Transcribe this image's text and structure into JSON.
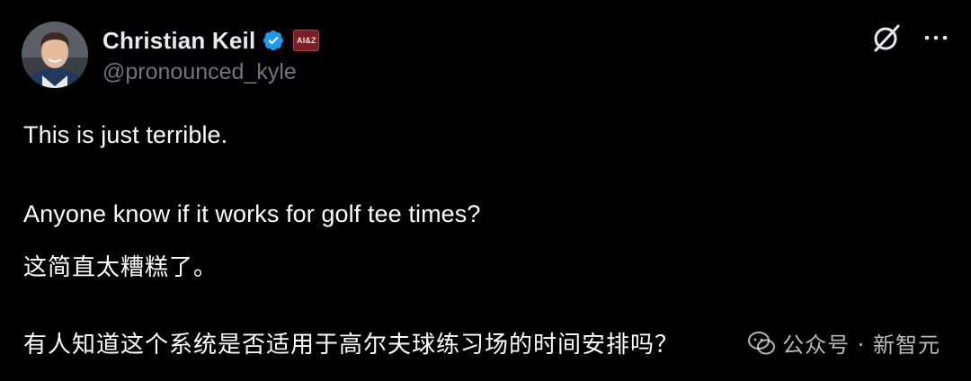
{
  "tweet": {
    "author": {
      "display_name": "Christian Keil",
      "handle": "@pronounced_kyle",
      "verified": true,
      "affiliate_badge": "AI&Z",
      "avatar": "avatar-photo"
    },
    "actions": {
      "grok_icon": "grok-icon",
      "more_icon": "more-icon"
    },
    "lines": [
      "This is just terrible.",
      "Anyone know if it works for golf tee times?",
      "这简直太糟糕了。",
      "有人知道这个系统是否适用于高尔夫球练习场的时间安排吗？"
    ]
  },
  "watermark": {
    "text": "公众号 · 新智元",
    "logo": "wechat-icon"
  },
  "colors": {
    "background": "#000000",
    "text": "#ffffff",
    "secondary_text": "#71767b",
    "verified_blue": "#1d9bf0",
    "affiliate_badge": "#7a1e24"
  }
}
